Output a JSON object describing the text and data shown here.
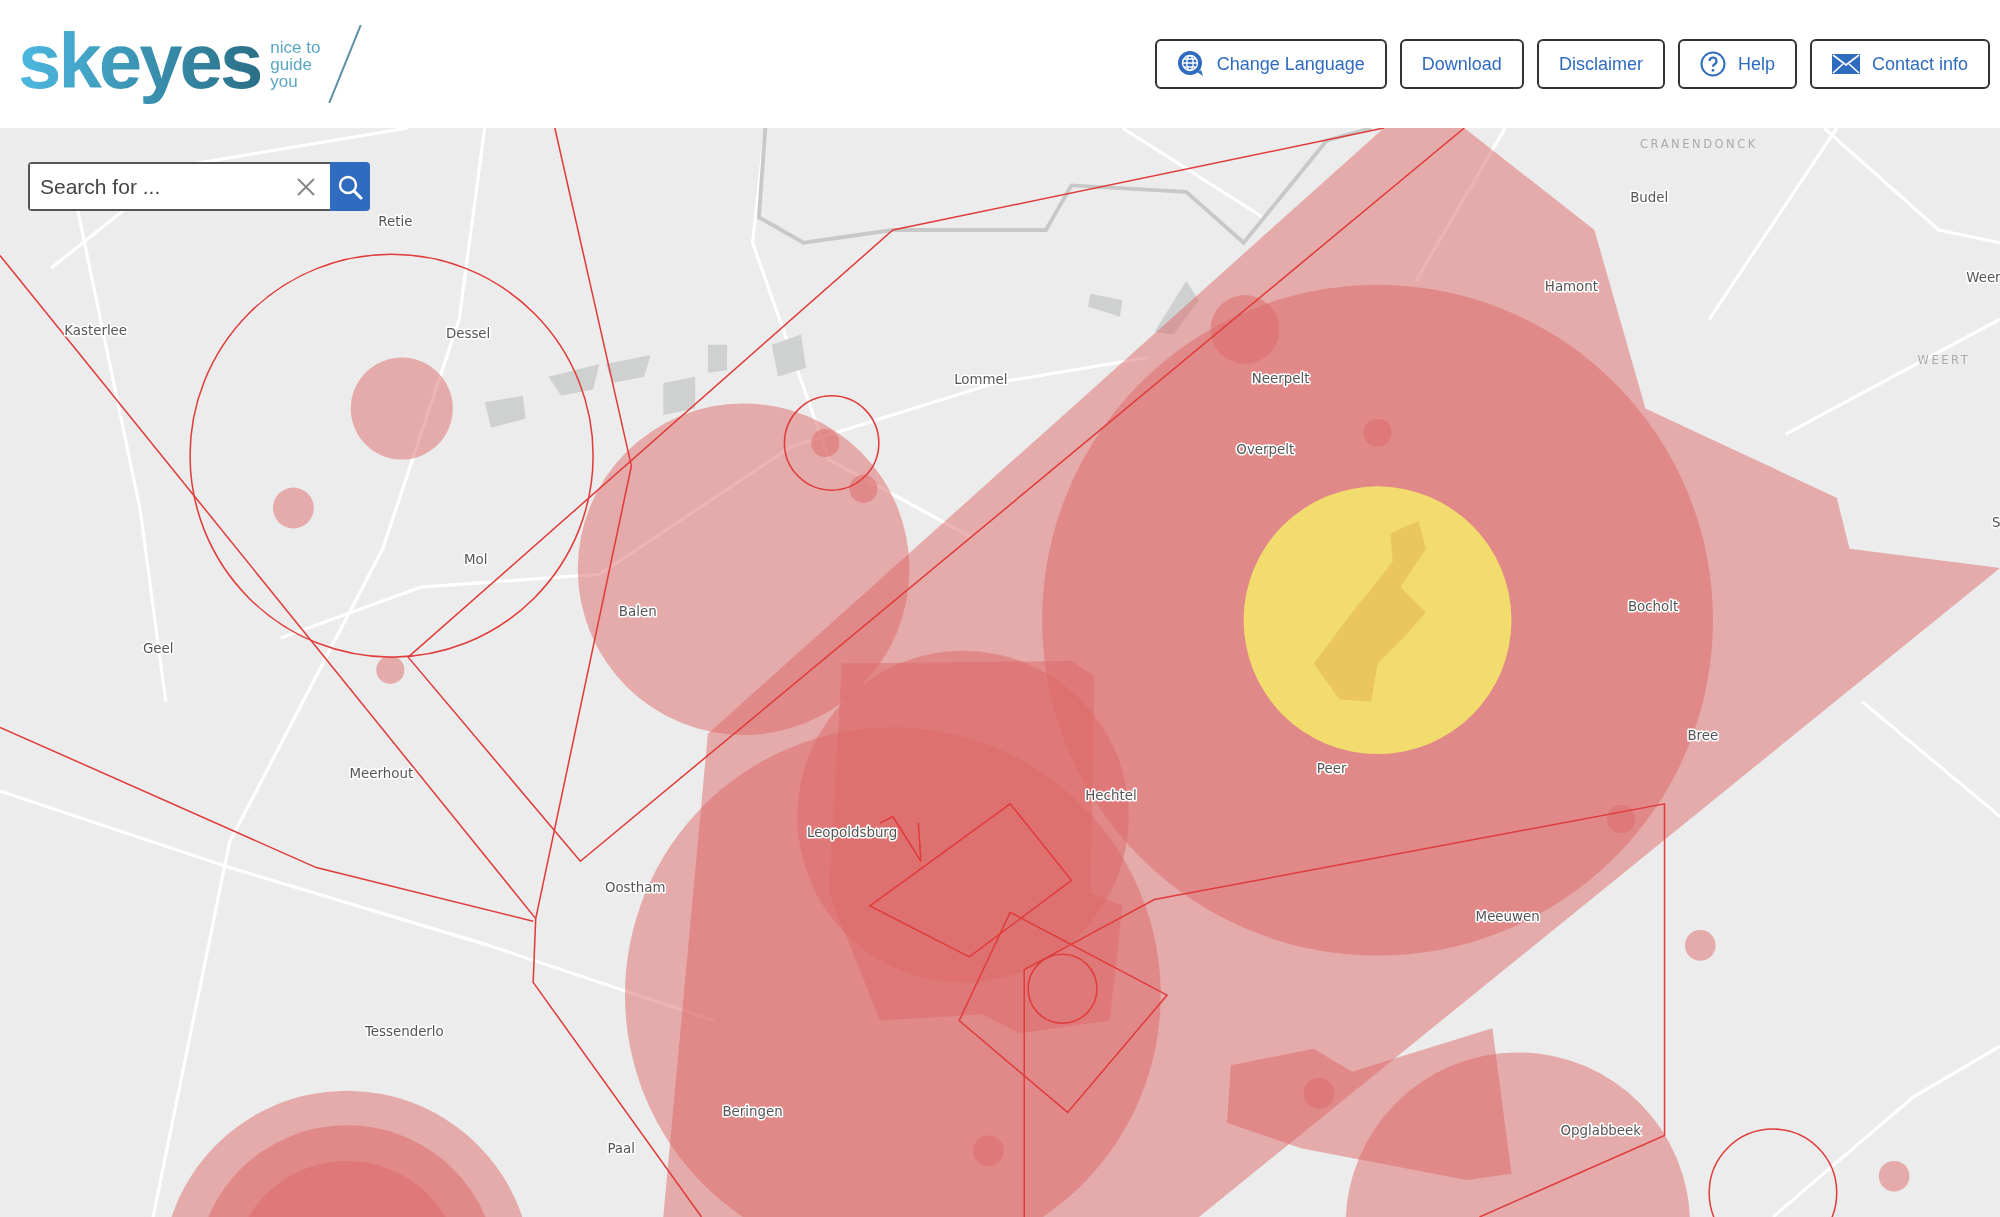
{
  "header": {
    "logo": "skeyes",
    "tagline": [
      "nice to",
      "guide",
      "you"
    ],
    "buttons": [
      {
        "label": "Change Language",
        "kind": "language"
      },
      {
        "label": "Download",
        "kind": "plain"
      },
      {
        "label": "Disclaimer",
        "kind": "plain"
      },
      {
        "label": "Help",
        "kind": "help"
      },
      {
        "label": "Contact info",
        "kind": "contact"
      }
    ]
  },
  "search": {
    "placeholder": "Search for ..."
  },
  "map": {
    "place_labels": [
      {
        "text": "CRANENDONCK",
        "kind": "region"
      },
      {
        "text": "Budel",
        "kind": "town"
      },
      {
        "text": "Retie",
        "kind": "town"
      },
      {
        "text": "Hamont",
        "kind": "town"
      },
      {
        "text": "Weer",
        "kind": "town"
      },
      {
        "text": "Kasterlee",
        "kind": "town"
      },
      {
        "text": "Dessel",
        "kind": "town"
      },
      {
        "text": "WEERT",
        "kind": "region"
      },
      {
        "text": "Lommel",
        "kind": "town"
      },
      {
        "text": "Neerpelt",
        "kind": "town"
      },
      {
        "text": "Overpelt",
        "kind": "town"
      },
      {
        "text": "S",
        "kind": "town"
      },
      {
        "text": "Mol",
        "kind": "town"
      },
      {
        "text": "Bocholt",
        "kind": "town"
      },
      {
        "text": "Balen",
        "kind": "town"
      },
      {
        "text": "Geel",
        "kind": "town"
      },
      {
        "text": "Bree",
        "kind": "town"
      },
      {
        "text": "Peer",
        "kind": "town"
      },
      {
        "text": "Meerhout",
        "kind": "town"
      },
      {
        "text": "Hechtel",
        "kind": "town"
      },
      {
        "text": "Leopoldsburg",
        "kind": "town"
      },
      {
        "text": "Oostham",
        "kind": "town"
      },
      {
        "text": "Meeuwen",
        "kind": "town"
      },
      {
        "text": "Tessenderlo",
        "kind": "town"
      },
      {
        "text": "Beringen",
        "kind": "town"
      },
      {
        "text": "Opglabbeek",
        "kind": "town"
      },
      {
        "text": "Paal",
        "kind": "town"
      }
    ]
  }
}
